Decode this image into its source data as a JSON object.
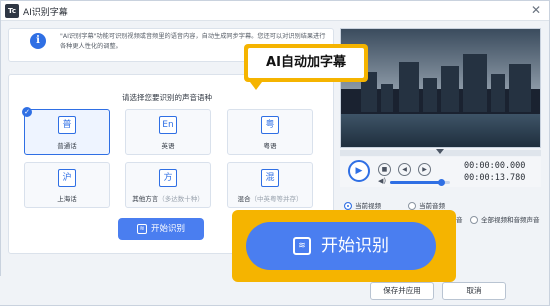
{
  "window": {
    "logo_text": "Tc",
    "title": "AI识别字幕",
    "close_glyph": "✕"
  },
  "info": {
    "icon_glyph": "i",
    "text": "\"AI识别字幕\"功能可识别视频或音频里的语音内容，自动生成同步字幕。您还可以对识别结果进行各种更人性化的调整。"
  },
  "panel": {
    "prompt": "请选择您要识别的声音语种",
    "languages": [
      {
        "glyph": "普",
        "name": "普通话",
        "sub": "",
        "selected": true
      },
      {
        "glyph": "En",
        "name": "英语",
        "sub": "",
        "selected": false
      },
      {
        "glyph": "粤",
        "name": "粤语",
        "sub": "",
        "selected": false
      },
      {
        "glyph": "沪",
        "name": "上海话",
        "sub": "",
        "selected": false
      },
      {
        "glyph": "方",
        "name": "其他方言",
        "sub": "（多达数十种）",
        "selected": false
      },
      {
        "glyph": "混",
        "name": "混合",
        "sub": "（中英粤等并存）",
        "selected": false
      }
    ],
    "check_glyph": "✓",
    "start_small_label": "开始识别",
    "wave_glyph": "≋"
  },
  "player": {
    "play_glyph": "▶",
    "stop_glyph": "■",
    "prev_glyph": "◀",
    "next_glyph": "▶",
    "vol_glyph": "◀)",
    "time_current": "00:00:00.000",
    "time_total": "00:00:13.780",
    "volume_level": 0.85
  },
  "source": {
    "option_current_video": "当前视频",
    "option_current_audio": "当前音频",
    "option_all": "全部视频和音频声音",
    "option_partial_peek": "音"
  },
  "footer": {
    "apply_label": "保存并应用",
    "cancel_label": "取消"
  },
  "callout": {
    "text": "AI自动加字幕"
  },
  "big_button": {
    "label": "开始识别",
    "wave_glyph": "≋"
  },
  "colors": {
    "accent": "#2f6fe4",
    "button_blue": "#4a7ef0",
    "highlight": "#f5b400"
  }
}
